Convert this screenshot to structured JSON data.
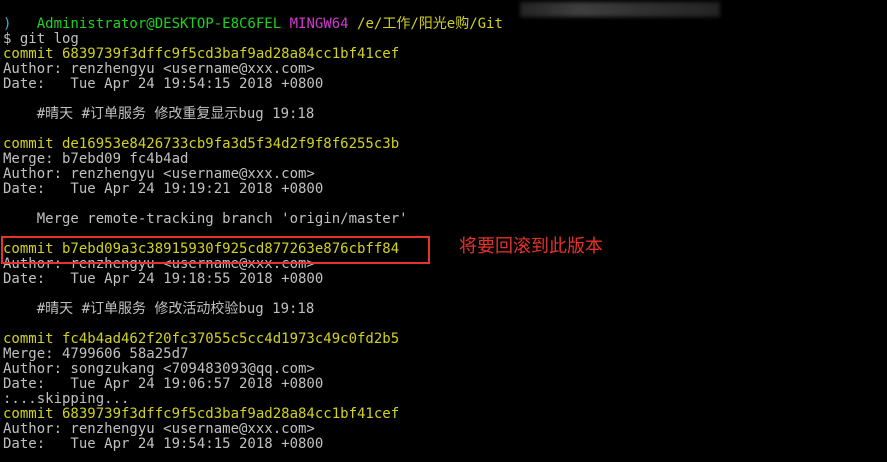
{
  "colors": {
    "background": "#000000",
    "text": "#c0c0c0",
    "prompt_user": "#1fd21f",
    "prompt_shell": "#d238d2",
    "prompt_path": "#d2d21f",
    "commit_hash": "#d2d21f",
    "prompt_paren": "#2db3d8",
    "annotation": "#e5322c"
  },
  "prompt": {
    "user_host": "Administrator@DESKTOP-E8C6FEL",
    "shell": "MINGW64",
    "path": "/e/工作/阳光e购/Git",
    "paren_close": ")",
    "command": "$ git log"
  },
  "log": [
    {
      "kind": "commit",
      "text": "commit 6839739f3dffc9f5cd3baf9ad28a84cc1bf41cef"
    },
    {
      "kind": "text",
      "text": "Author: renzhengyu <username@xxx.com>"
    },
    {
      "kind": "text",
      "text": "Date:   Tue Apr 24 19:54:15 2018 +0800"
    },
    {
      "kind": "blank",
      "text": ""
    },
    {
      "kind": "text",
      "text": "    #晴天 #订单服务 修改重复显示bug 19:18"
    },
    {
      "kind": "blank",
      "text": ""
    },
    {
      "kind": "commit",
      "text": "commit de16953e8426733cb9fa3d5f34d2f9f8f6255c3b"
    },
    {
      "kind": "text",
      "text": "Merge: b7ebd09 fc4b4ad"
    },
    {
      "kind": "text",
      "text": "Author: renzhengyu <username@xxx.com>"
    },
    {
      "kind": "text",
      "text": "Date:   Tue Apr 24 19:19:21 2018 +0800"
    },
    {
      "kind": "blank",
      "text": ""
    },
    {
      "kind": "text",
      "text": "    Merge remote-tracking branch 'origin/master'"
    },
    {
      "kind": "blank",
      "text": ""
    },
    {
      "kind": "commit",
      "text": "commit b7ebd09a3c38915930f925cd877263e876cbff84"
    },
    {
      "kind": "text",
      "text": "Author: renzhengyu <username@xxx.com>"
    },
    {
      "kind": "text",
      "text": "Date:   Tue Apr 24 19:18:55 2018 +0800"
    },
    {
      "kind": "blank",
      "text": ""
    },
    {
      "kind": "text",
      "text": "    #晴天 #订单服务 修改活动校验bug 19:18"
    },
    {
      "kind": "blank",
      "text": ""
    },
    {
      "kind": "commit",
      "text": "commit fc4b4ad462f20fc37055c5cc4d1973c49c0fd2b5"
    },
    {
      "kind": "text",
      "text": "Merge: 4799606 58a25d7"
    },
    {
      "kind": "text",
      "text": "Author: songzukang <709483093@qq.com>"
    },
    {
      "kind": "text",
      "text": "Date:   Tue Apr 24 19:06:57 2018 +0800"
    },
    {
      "kind": "text",
      "text": ":...skipping..."
    },
    {
      "kind": "commit",
      "text": "commit 6839739f3dffc9f5cd3baf9ad28a84cc1bf41cef"
    },
    {
      "kind": "text",
      "text": "Author: renzhengyu <username@xxx.com>"
    },
    {
      "kind": "text",
      "text": "Date:   Tue Apr 24 19:54:15 2018 +0800"
    }
  ],
  "annotation": {
    "text": "将要回滚到此版本"
  }
}
